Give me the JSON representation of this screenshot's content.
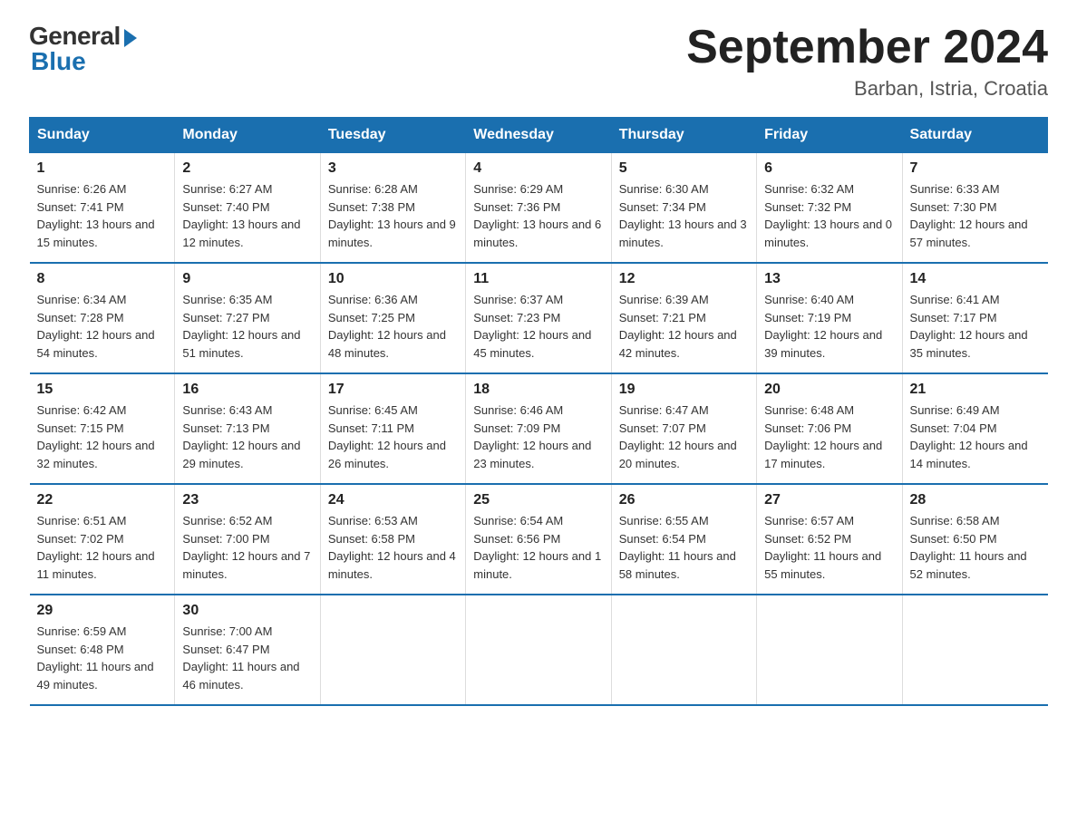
{
  "logo": {
    "general": "General",
    "blue": "Blue"
  },
  "calendar": {
    "title": "September 2024",
    "subtitle": "Barban, Istria, Croatia"
  },
  "headers": [
    "Sunday",
    "Monday",
    "Tuesday",
    "Wednesday",
    "Thursday",
    "Friday",
    "Saturday"
  ],
  "weeks": [
    [
      {
        "day": "1",
        "sunrise": "6:26 AM",
        "sunset": "7:41 PM",
        "daylight": "13 hours and 15 minutes."
      },
      {
        "day": "2",
        "sunrise": "6:27 AM",
        "sunset": "7:40 PM",
        "daylight": "13 hours and 12 minutes."
      },
      {
        "day": "3",
        "sunrise": "6:28 AM",
        "sunset": "7:38 PM",
        "daylight": "13 hours and 9 minutes."
      },
      {
        "day": "4",
        "sunrise": "6:29 AM",
        "sunset": "7:36 PM",
        "daylight": "13 hours and 6 minutes."
      },
      {
        "day": "5",
        "sunrise": "6:30 AM",
        "sunset": "7:34 PM",
        "daylight": "13 hours and 3 minutes."
      },
      {
        "day": "6",
        "sunrise": "6:32 AM",
        "sunset": "7:32 PM",
        "daylight": "13 hours and 0 minutes."
      },
      {
        "day": "7",
        "sunrise": "6:33 AM",
        "sunset": "7:30 PM",
        "daylight": "12 hours and 57 minutes."
      }
    ],
    [
      {
        "day": "8",
        "sunrise": "6:34 AM",
        "sunset": "7:28 PM",
        "daylight": "12 hours and 54 minutes."
      },
      {
        "day": "9",
        "sunrise": "6:35 AM",
        "sunset": "7:27 PM",
        "daylight": "12 hours and 51 minutes."
      },
      {
        "day": "10",
        "sunrise": "6:36 AM",
        "sunset": "7:25 PM",
        "daylight": "12 hours and 48 minutes."
      },
      {
        "day": "11",
        "sunrise": "6:37 AM",
        "sunset": "7:23 PM",
        "daylight": "12 hours and 45 minutes."
      },
      {
        "day": "12",
        "sunrise": "6:39 AM",
        "sunset": "7:21 PM",
        "daylight": "12 hours and 42 minutes."
      },
      {
        "day": "13",
        "sunrise": "6:40 AM",
        "sunset": "7:19 PM",
        "daylight": "12 hours and 39 minutes."
      },
      {
        "day": "14",
        "sunrise": "6:41 AM",
        "sunset": "7:17 PM",
        "daylight": "12 hours and 35 minutes."
      }
    ],
    [
      {
        "day": "15",
        "sunrise": "6:42 AM",
        "sunset": "7:15 PM",
        "daylight": "12 hours and 32 minutes."
      },
      {
        "day": "16",
        "sunrise": "6:43 AM",
        "sunset": "7:13 PM",
        "daylight": "12 hours and 29 minutes."
      },
      {
        "day": "17",
        "sunrise": "6:45 AM",
        "sunset": "7:11 PM",
        "daylight": "12 hours and 26 minutes."
      },
      {
        "day": "18",
        "sunrise": "6:46 AM",
        "sunset": "7:09 PM",
        "daylight": "12 hours and 23 minutes."
      },
      {
        "day": "19",
        "sunrise": "6:47 AM",
        "sunset": "7:07 PM",
        "daylight": "12 hours and 20 minutes."
      },
      {
        "day": "20",
        "sunrise": "6:48 AM",
        "sunset": "7:06 PM",
        "daylight": "12 hours and 17 minutes."
      },
      {
        "day": "21",
        "sunrise": "6:49 AM",
        "sunset": "7:04 PM",
        "daylight": "12 hours and 14 minutes."
      }
    ],
    [
      {
        "day": "22",
        "sunrise": "6:51 AM",
        "sunset": "7:02 PM",
        "daylight": "12 hours and 11 minutes."
      },
      {
        "day": "23",
        "sunrise": "6:52 AM",
        "sunset": "7:00 PM",
        "daylight": "12 hours and 7 minutes."
      },
      {
        "day": "24",
        "sunrise": "6:53 AM",
        "sunset": "6:58 PM",
        "daylight": "12 hours and 4 minutes."
      },
      {
        "day": "25",
        "sunrise": "6:54 AM",
        "sunset": "6:56 PM",
        "daylight": "12 hours and 1 minute."
      },
      {
        "day": "26",
        "sunrise": "6:55 AM",
        "sunset": "6:54 PM",
        "daylight": "11 hours and 58 minutes."
      },
      {
        "day": "27",
        "sunrise": "6:57 AM",
        "sunset": "6:52 PM",
        "daylight": "11 hours and 55 minutes."
      },
      {
        "day": "28",
        "sunrise": "6:58 AM",
        "sunset": "6:50 PM",
        "daylight": "11 hours and 52 minutes."
      }
    ],
    [
      {
        "day": "29",
        "sunrise": "6:59 AM",
        "sunset": "6:48 PM",
        "daylight": "11 hours and 49 minutes."
      },
      {
        "day": "30",
        "sunrise": "7:00 AM",
        "sunset": "6:47 PM",
        "daylight": "11 hours and 46 minutes."
      },
      null,
      null,
      null,
      null,
      null
    ]
  ]
}
